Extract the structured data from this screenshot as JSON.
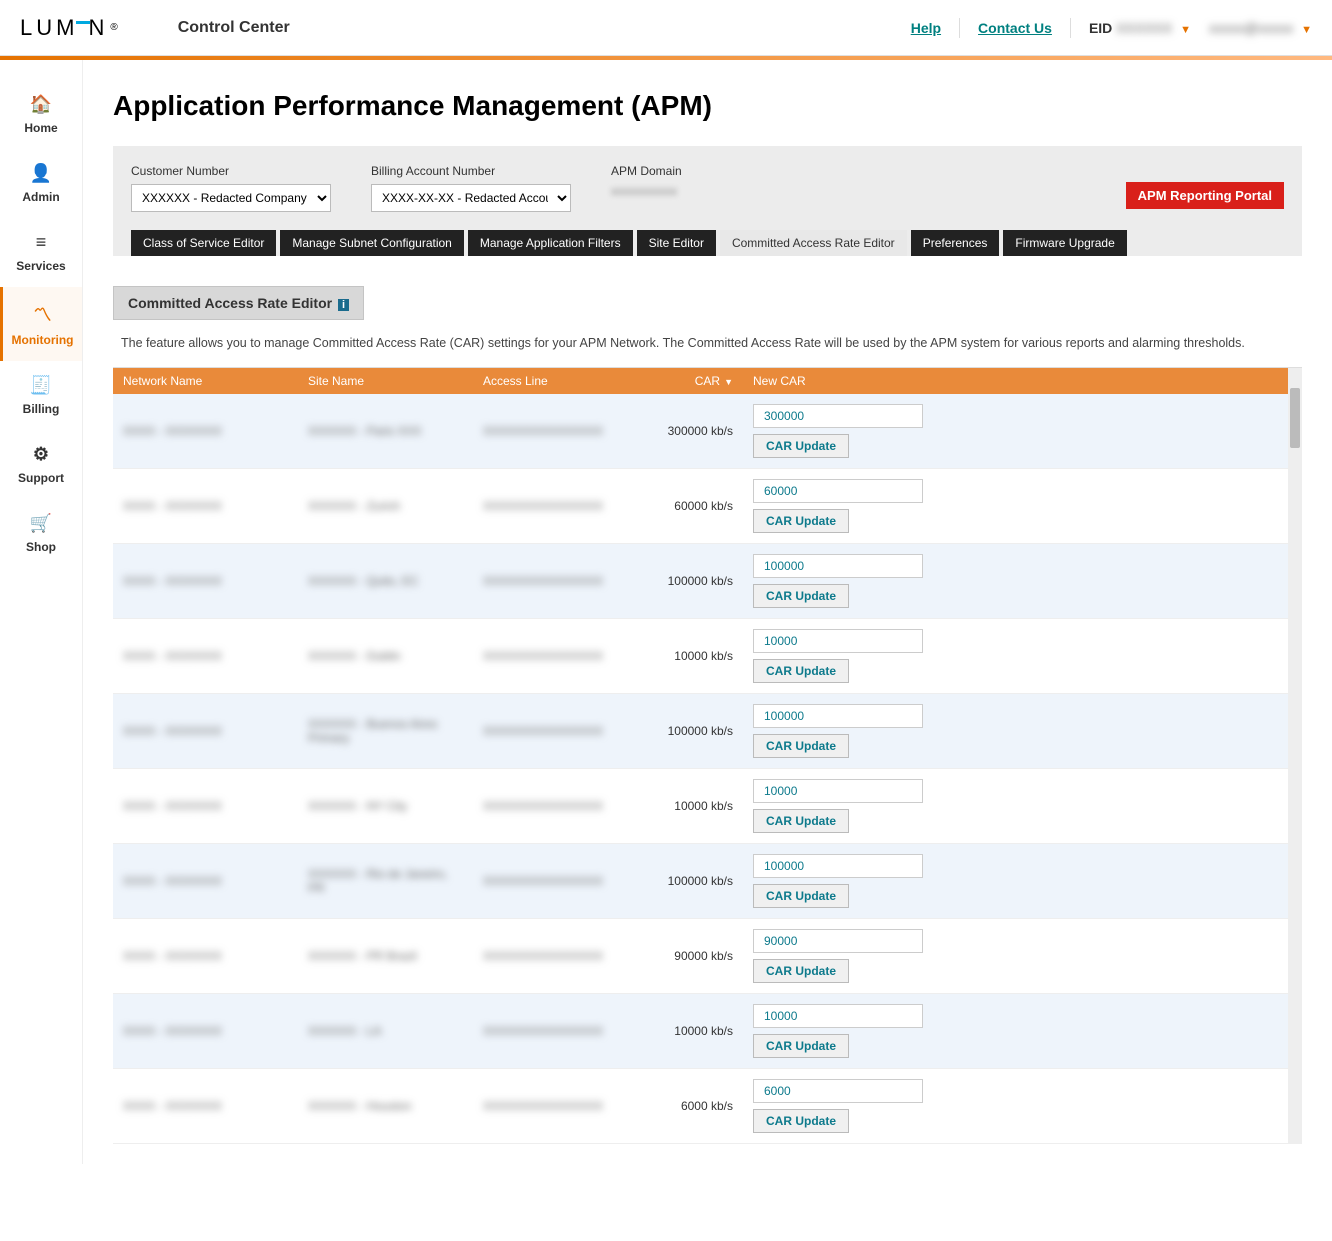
{
  "header": {
    "logo_text": "LUM",
    "logo_text2": "N",
    "app_title": "Control Center",
    "help": "Help",
    "contact": "Contact Us",
    "eid_label": "EID",
    "eid_value": "XXXXXX",
    "user_email": "xxxxx@xxxxx"
  },
  "sidebar": {
    "items": [
      {
        "label": "Home",
        "icon": "🏠"
      },
      {
        "label": "Admin",
        "icon": "👤"
      },
      {
        "label": "Services",
        "icon": "≡"
      },
      {
        "label": "Monitoring",
        "icon": "〽"
      },
      {
        "label": "Billing",
        "icon": "🧾"
      },
      {
        "label": "Support",
        "icon": "⚙"
      },
      {
        "label": "Shop",
        "icon": "🛒"
      }
    ]
  },
  "page": {
    "heading": "Application Performance Management (APM)"
  },
  "filters": {
    "customer_label": "Customer Number",
    "customer_value": "XXXXXX - Redacted Company Name",
    "billing_label": "Billing Account Number",
    "billing_value": "XXXX-XX-XX - Redacted Account",
    "domain_label": "APM Domain",
    "domain_value": "xxxxxxxxxxx",
    "portal_btn": "APM Reporting Portal"
  },
  "tabs": [
    {
      "label": "Class of Service Editor",
      "active": false
    },
    {
      "label": "Manage Subnet Configuration",
      "active": false
    },
    {
      "label": "Manage Application Filters",
      "active": false
    },
    {
      "label": "Site Editor",
      "active": false
    },
    {
      "label": "Committed Access Rate Editor",
      "active": true
    },
    {
      "label": "Preferences",
      "active": false
    },
    {
      "label": "Firmware Upgrade",
      "active": false
    }
  ],
  "section": {
    "title": "Committed Access Rate Editor",
    "description": "The feature allows you to manage Committed Access Rate (CAR) settings for your APM Network. The Committed Access Rate will be used by the APM system for various reports and alarming thresholds."
  },
  "table": {
    "headers": {
      "network": "Network Name",
      "site": "Site Name",
      "access": "Access Line",
      "car": "CAR",
      "newcar": "New CAR"
    },
    "update_btn": "CAR Update",
    "rows": [
      {
        "network": "XXXX - XXXXXXX",
        "site": "XXXXXX - Paris XXX",
        "access": "XXXXXXXXXXXXXXX",
        "car": "300000 kb/s",
        "newcar": "300000"
      },
      {
        "network": "XXXX - XXXXXXX",
        "site": "XXXXXX - Zurich",
        "access": "XXXXXXXXXXXXXXX",
        "car": "60000 kb/s",
        "newcar": "60000"
      },
      {
        "network": "XXXX - XXXXXXX",
        "site": "XXXXXX - Quito, EC",
        "access": "XXXXXXXXXXXXXXX",
        "car": "100000 kb/s",
        "newcar": "100000"
      },
      {
        "network": "XXXX - XXXXXXX",
        "site": "XXXXXX - Dublin",
        "access": "XXXXXXXXXXXXXXX",
        "car": "10000 kb/s",
        "newcar": "10000"
      },
      {
        "network": "XXXX - XXXXXXX",
        "site": "XXXXXX - Buenos Aires Primary",
        "access": "XXXXXXXXXXXXXXX",
        "car": "100000 kb/s",
        "newcar": "100000"
      },
      {
        "network": "XXXX - XXXXXXX",
        "site": "XXXXXX - NY City",
        "access": "XXXXXXXXXXXXXXX",
        "car": "10000 kb/s",
        "newcar": "10000"
      },
      {
        "network": "XXXX - XXXXXXX",
        "site": "XXXXXX - Rio de Janeiro, PR",
        "access": "XXXXXXXXXXXXXXX",
        "car": "100000 kb/s",
        "newcar": "100000"
      },
      {
        "network": "XXXX - XXXXXXX",
        "site": "XXXXXX - PR Brazil",
        "access": "XXXXXXXXXXXXXXX",
        "car": "90000 kb/s",
        "newcar": "90000"
      },
      {
        "network": "XXXX - XXXXXXX",
        "site": "XXXXXX - LA",
        "access": "XXXXXXXXXXXXXXX",
        "car": "10000 kb/s",
        "newcar": "10000"
      },
      {
        "network": "XXXX - XXXXXXX",
        "site": "XXXXXX - Houston",
        "access": "XXXXXXXXXXXXXXX",
        "car": "6000 kb/s",
        "newcar": "6000"
      }
    ]
  }
}
